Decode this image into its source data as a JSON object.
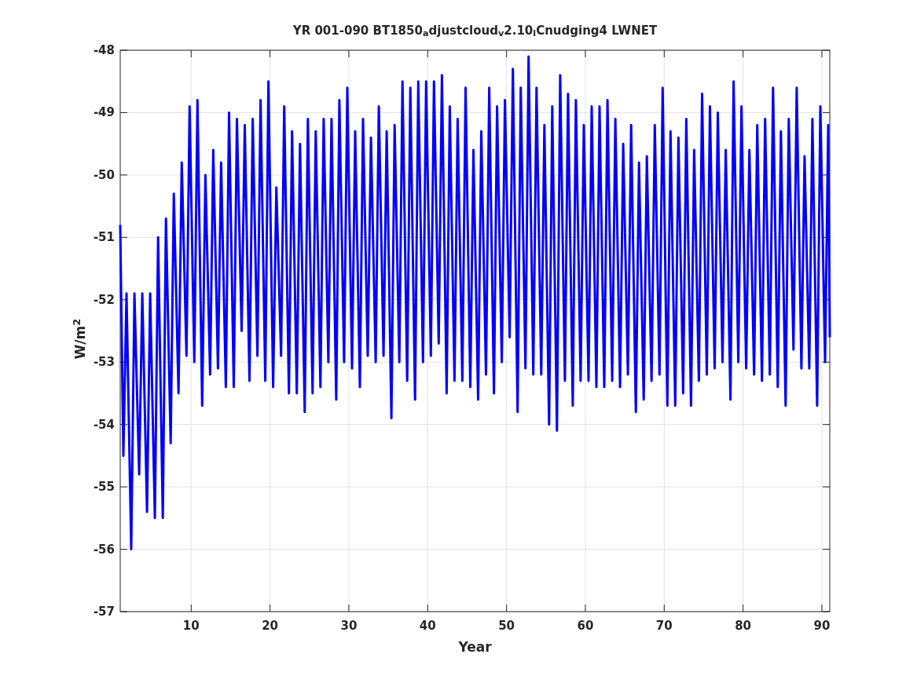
{
  "figure": {
    "chart_data": {
      "type": "line",
      "title": "YR 001-090 BT1850$_{a}$djustcloud$_{v}$2.10$_{l}$Cnudging4 LWNET",
      "xlabel": "Year",
      "ylabel": "W/m$^{2}$",
      "grid": true,
      "xlim": [
        1,
        91
      ],
      "ylim": [
        -57,
        -48
      ],
      "xticks": [
        10,
        20,
        30,
        40,
        50,
        60,
        70,
        80,
        90
      ],
      "yticks": [
        -57,
        -56,
        -55,
        -54,
        -53,
        -52,
        -51,
        -50,
        -49,
        -48
      ],
      "x": [
        1,
        1.4,
        1.8,
        2.4,
        2.8,
        3.4,
        3.8,
        4.4,
        4.8,
        5.4,
        5.8,
        6.4,
        6.8,
        7.4,
        7.8,
        8.4,
        8.8,
        9.4,
        9.8,
        10.4,
        10.8,
        11.4,
        11.8,
        12.4,
        12.8,
        13.4,
        13.8,
        14.4,
        14.8,
        15.4,
        15.8,
        16.4,
        16.8,
        17.4,
        17.8,
        18.4,
        18.8,
        19.4,
        19.8,
        20.4,
        20.8,
        21.4,
        21.8,
        22.4,
        22.8,
        23.4,
        23.8,
        24.4,
        24.8,
        25.4,
        25.8,
        26.4,
        26.8,
        27.4,
        27.8,
        28.4,
        28.8,
        29.4,
        29.8,
        30.4,
        30.8,
        31.4,
        31.8,
        32.4,
        32.8,
        33.4,
        33.8,
        34.4,
        34.8,
        35.4,
        35.8,
        36.4,
        36.8,
        37.4,
        37.8,
        38.4,
        38.8,
        39.4,
        39.8,
        40.4,
        40.8,
        41.4,
        41.8,
        42.4,
        42.8,
        43.4,
        43.8,
        44.4,
        44.8,
        45.4,
        45.8,
        46.4,
        46.8,
        47.4,
        47.8,
        48.4,
        48.8,
        49.4,
        49.8,
        50.4,
        50.8,
        51.4,
        51.8,
        52.4,
        52.8,
        53.4,
        53.8,
        54.4,
        54.8,
        55.4,
        55.8,
        56.4,
        56.8,
        57.4,
        57.8,
        58.4,
        58.8,
        59.4,
        59.8,
        60.4,
        60.8,
        61.4,
        61.8,
        62.4,
        62.8,
        63.4,
        63.8,
        64.4,
        64.8,
        65.4,
        65.8,
        66.4,
        66.8,
        67.4,
        67.8,
        68.4,
        68.8,
        69.4,
        69.8,
        70.4,
        70.8,
        71.4,
        71.8,
        72.4,
        72.8,
        73.4,
        73.8,
        74.4,
        74.8,
        75.4,
        75.8,
        76.4,
        76.8,
        77.4,
        77.8,
        78.4,
        78.8,
        79.4,
        79.8,
        80.4,
        80.8,
        81.4,
        81.8,
        82.4,
        82.8,
        83.4,
        83.8,
        84.4,
        84.8,
        85.4,
        85.8,
        86.4,
        86.8,
        87.4,
        87.8,
        88.4,
        88.8,
        89.4,
        89.8,
        90.4,
        90.8,
        91
      ],
      "series": [
        {
          "color": "#0000ff",
          "values": [
            -50.8,
            -54.5,
            -51.9,
            -56.0,
            -51.9,
            -54.8,
            -51.9,
            -55.4,
            -51.9,
            -55.5,
            -51.0,
            -55.5,
            -50.7,
            -54.3,
            -50.3,
            -53.5,
            -49.8,
            -52.9,
            -48.9,
            -53.0,
            -48.8,
            -53.7,
            -50.0,
            -53.2,
            -49.6,
            -53.1,
            -49.8,
            -53.4,
            -49.0,
            -53.4,
            -49.1,
            -52.5,
            -49.2,
            -53.3,
            -49.1,
            -52.9,
            -48.8,
            -53.3,
            -48.5,
            -53.4,
            -50.2,
            -52.9,
            -48.9,
            -53.5,
            -49.3,
            -53.5,
            -49.5,
            -53.8,
            -49.1,
            -53.5,
            -49.3,
            -53.4,
            -49.1,
            -53.0,
            -49.1,
            -53.6,
            -48.8,
            -53.0,
            -48.6,
            -53.1,
            -49.3,
            -53.4,
            -49.1,
            -52.9,
            -49.4,
            -53.0,
            -48.9,
            -52.9,
            -49.3,
            -53.9,
            -49.2,
            -53.0,
            -48.5,
            -53.3,
            -48.6,
            -53.6,
            -48.5,
            -53.0,
            -48.5,
            -52.9,
            -48.5,
            -52.7,
            -48.4,
            -53.5,
            -48.9,
            -53.3,
            -49.1,
            -53.3,
            -48.6,
            -53.4,
            -49.6,
            -53.6,
            -49.3,
            -53.2,
            -48.6,
            -53.5,
            -48.9,
            -53.0,
            -48.8,
            -52.6,
            -48.3,
            -53.8,
            -48.6,
            -53.1,
            -48.1,
            -53.2,
            -48.6,
            -53.2,
            -49.2,
            -54.0,
            -48.9,
            -54.1,
            -48.4,
            -53.3,
            -48.7,
            -53.7,
            -48.8,
            -53.3,
            -49.2,
            -53.3,
            -48.9,
            -53.4,
            -48.9,
            -53.4,
            -48.8,
            -53.3,
            -49.1,
            -53.4,
            -49.5,
            -53.2,
            -49.2,
            -53.8,
            -49.8,
            -53.6,
            -49.7,
            -53.3,
            -49.2,
            -53.2,
            -48.6,
            -53.7,
            -49.3,
            -53.7,
            -49.4,
            -53.5,
            -49.1,
            -53.7,
            -49.6,
            -53.3,
            -48.7,
            -53.2,
            -48.9,
            -53.1,
            -49.0,
            -53.0,
            -49.6,
            -53.6,
            -48.5,
            -53.0,
            -48.9,
            -53.1,
            -49.6,
            -53.2,
            -49.2,
            -53.3,
            -49.1,
            -53.2,
            -48.6,
            -53.4,
            -49.3,
            -53.7,
            -49.1,
            -52.8,
            -48.6,
            -53.1,
            -49.7,
            -53.1,
            -49.1,
            -53.7,
            -48.9,
            -53.0,
            -49.2,
            -52.6
          ]
        }
      ]
    }
  }
}
